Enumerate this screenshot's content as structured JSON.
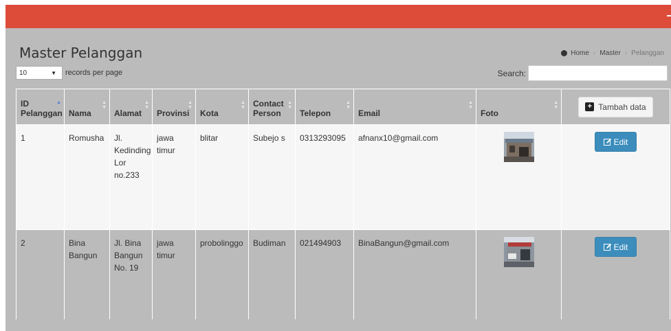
{
  "page": {
    "title": "Master Pelanggan"
  },
  "breadcrumb": {
    "home": "Home",
    "master": "Master",
    "current": "Pelanggan"
  },
  "table_controls": {
    "length_value": "10",
    "length_suffix": "records per page",
    "search_label": "Search:",
    "search_value": ""
  },
  "table": {
    "headers": {
      "id": "ID Pelanggan",
      "nama": "Nama",
      "alamat": "Alamat",
      "provinsi": "Provinsi",
      "kota": "Kota",
      "contact": "Contact Person",
      "telepon": "Telepon",
      "email": "Email",
      "foto": "Foto"
    },
    "add_button": "Tambah data",
    "edit_label": "Edit",
    "rows": [
      {
        "id": "1",
        "nama": "Romusha",
        "alamat": "Jl. Kedinding Lor no.233",
        "provinsi": "jawa timur",
        "kota": "blitar",
        "contact": "Subejo s",
        "telepon": "0313293095",
        "email": "afnanx10@gmail.com"
      },
      {
        "id": "2",
        "nama": "Bina Bangun",
        "alamat": "Jl. Bina Bangun No. 19",
        "provinsi": "jawa timur",
        "kota": "probolinggo",
        "contact": "Budiman",
        "telepon": "021494903",
        "email": "BinaBangun@gmail.com"
      }
    ]
  },
  "colors": {
    "header_bar": "#dd4b39",
    "content_bg": "#bbbbbb",
    "primary": "#3c8dbc"
  }
}
